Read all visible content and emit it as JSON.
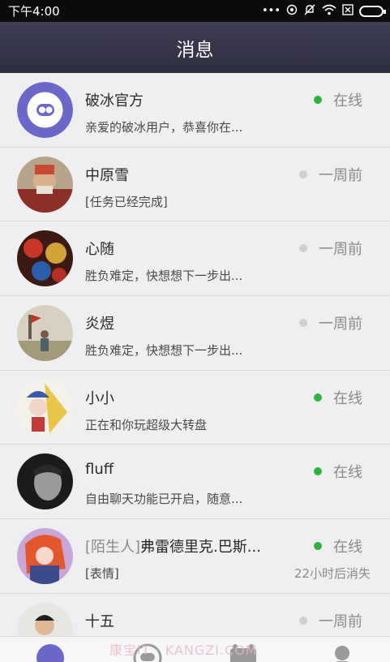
{
  "status_bar": {
    "time": "下午4:00",
    "icons": [
      "more-dots-icon",
      "hotspot-icon",
      "mute-icon",
      "wifi-icon",
      "sim-icon",
      "battery-icon"
    ]
  },
  "header": {
    "title": "消息"
  },
  "conversations": [
    {
      "name": "破冰官方",
      "preview": "亲爱的破冰用户，恭喜你在...",
      "status": "在线",
      "online": true
    },
    {
      "name": "中原雪",
      "preview": "[任务已经完成]",
      "status": "一周前",
      "online": false
    },
    {
      "name": "心随",
      "preview": "胜负难定，快想想下一步出...",
      "status": "一周前",
      "online": false
    },
    {
      "name": "炎煜",
      "preview": "胜负难定，快想想下一步出...",
      "status": "一周前",
      "online": false
    },
    {
      "name": "小小",
      "preview": "正在和你玩超级大转盘",
      "status": "在线",
      "online": true
    },
    {
      "name": "fluff",
      "preview": "自由聊天功能已开启，随意...",
      "status": "在线",
      "online": true
    },
    {
      "name_prefix": "[陌生人]",
      "name": "弗雷德里克.巴斯...",
      "preview": "[表情]",
      "status": "在线",
      "online": true,
      "expire": "22小时后消失"
    },
    {
      "name": "十五",
      "preview": "",
      "status": "一周前",
      "online": false
    }
  ],
  "bottom_nav": {
    "items": [
      "messages-tab-icon",
      "discover-tab-icon",
      "games-tab-icon",
      "profile-tab-icon"
    ],
    "watermark": "康宝IT · KANGZI.COM"
  },
  "colors": {
    "header": "#3a3950",
    "online": "#2fb33a",
    "accent": "#6b68c9"
  }
}
